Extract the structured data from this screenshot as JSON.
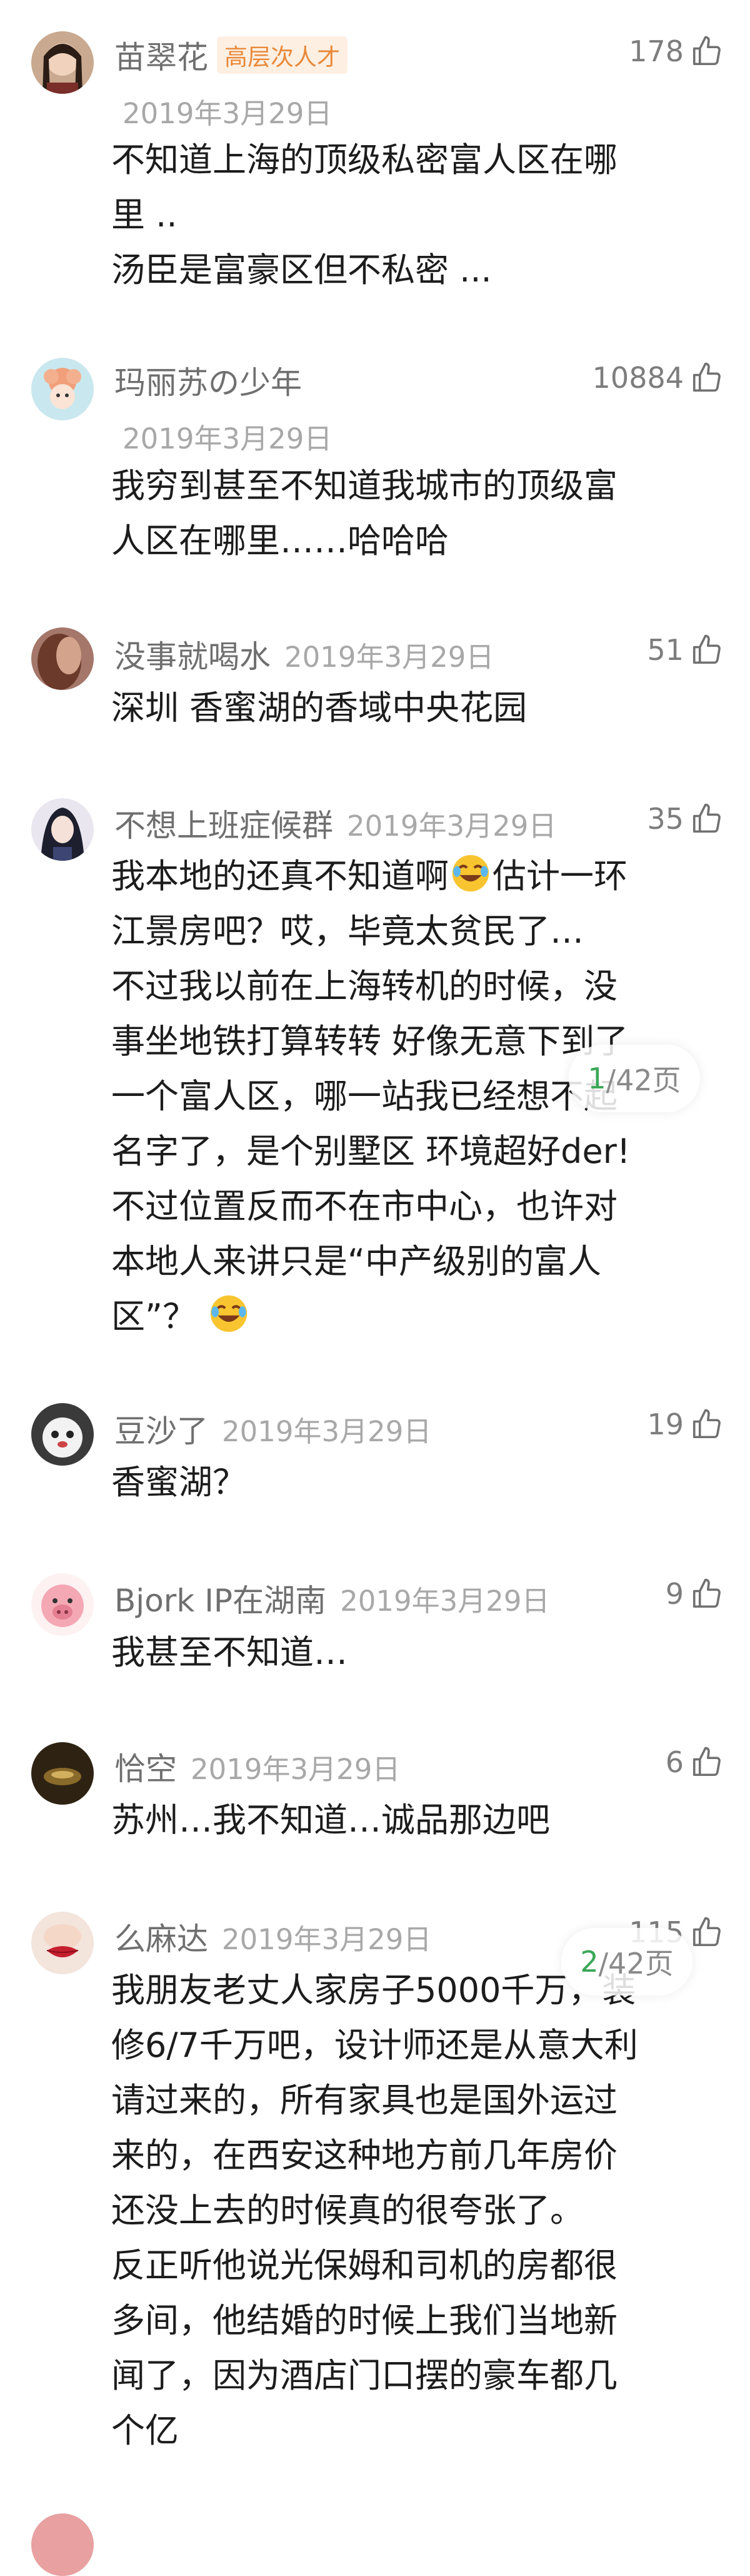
{
  "comments": [
    {
      "user": "苗翠花",
      "badge": "高层次人才",
      "date": "2019年3月29日",
      "likes": "178",
      "lines": [
        "不知道上海的顶级私密富人区在哪",
        "里 ..",
        "汤臣是富豪区但不私密 ..."
      ]
    },
    {
      "user": "玛丽苏の少年",
      "date": "2019年3月29日",
      "likes": "10884",
      "lines": [
        "我穷到甚至不知道我城市的顶级富",
        "人区在哪里……哈哈哈"
      ]
    },
    {
      "user": "没事就喝水",
      "date": "2019年3月29日",
      "likes": "51",
      "lines": [
        "深圳 香蜜湖的香域中央花园"
      ]
    },
    {
      "user": "不想上班症候群",
      "date": "2019年3月29日",
      "likes": "35",
      "lines": [
        "我本地的还真不知道啊",
        "估计一环",
        "江景房吧？哎，毕竟太贫民了…",
        "不过我以前在上海转机的时候，没",
        "事坐地铁打算转转 好像无意下到了",
        "一个富人区，哪一站我已经想不起",
        "名字了，是个别墅区 环境超好der!",
        "不过位置反而不在市中心，也许对",
        "本地人来讲只是“中产级别的富人",
        "区”？"
      ]
    },
    {
      "user": "豆沙了",
      "date": "2019年3月29日",
      "likes": "19",
      "lines": [
        "香蜜湖？"
      ]
    },
    {
      "user": "Bjork IP在湖南",
      "date": "2019年3月29日",
      "likes": "9",
      "lines": [
        "我甚至不知道…"
      ]
    },
    {
      "user": "恰空",
      "date": "2019年3月29日",
      "likes": "6",
      "lines": [
        "苏州…我不知道…诚品那边吧"
      ]
    },
    {
      "user": "么麻达",
      "date": "2019年3月29日",
      "likes": "115",
      "lines": [
        "我朋友老丈人家房子5000千万，装",
        "修6/7千万吧，设计师还是从意大利",
        "请过来的，所有家具也是国外运过",
        "来的，在西安这种地方前几年房价",
        "还没上去的时候真的很夸张了。",
        "反正听他说光保姆和司机的房都很",
        "多间，他结婚的时候上我们当地新",
        "闻了，因为酒店门口摆的豪车都几",
        "个亿"
      ]
    }
  ],
  "page_indicators": [
    {
      "current": "1",
      "rest": "/42页"
    },
    {
      "current": "2",
      "rest": "/42页"
    }
  ],
  "colors": {
    "accent_green": "#3aa757",
    "badge_orange": "#e8893a"
  }
}
